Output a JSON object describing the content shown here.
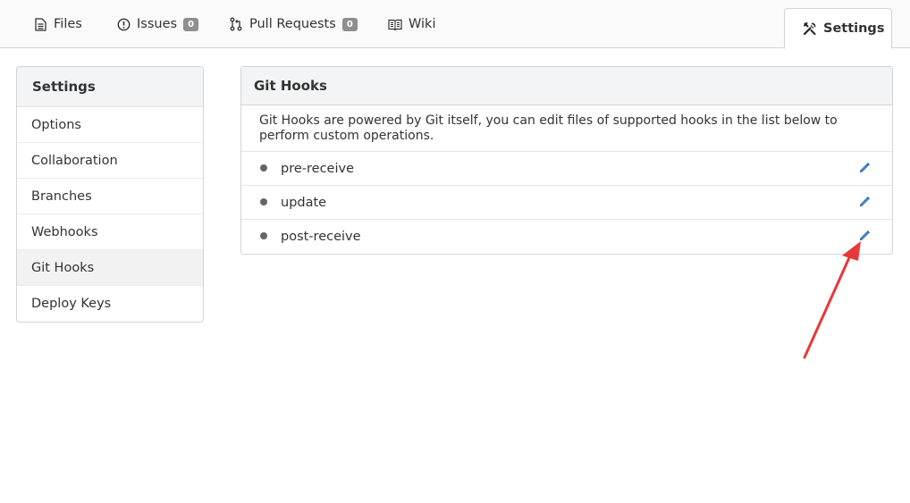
{
  "tabs": {
    "files": "Files",
    "issues": "Issues",
    "issues_count": "0",
    "pull_requests": "Pull Requests",
    "pull_requests_count": "0",
    "wiki": "Wiki",
    "settings": "Settings"
  },
  "sidebar": {
    "title": "Settings",
    "items": [
      "Options",
      "Collaboration",
      "Branches",
      "Webhooks",
      "Git Hooks",
      "Deploy Keys"
    ],
    "active": "Git Hooks"
  },
  "main": {
    "title": "Git Hooks",
    "description": "Git Hooks are powered by Git itself, you can edit files of supported hooks in the list below to perform custom operations.",
    "hooks": [
      "pre-receive",
      "update",
      "post-receive"
    ]
  },
  "colors": {
    "edit_icon": "#4183c4",
    "annotation_arrow": "#e8383a"
  },
  "icons": {
    "files": "file-text-icon",
    "issues": "issue-opened-icon",
    "pull_requests": "git-pull-request-icon",
    "wiki": "book-icon",
    "settings": "tools-icon",
    "edit": "pencil-icon"
  }
}
